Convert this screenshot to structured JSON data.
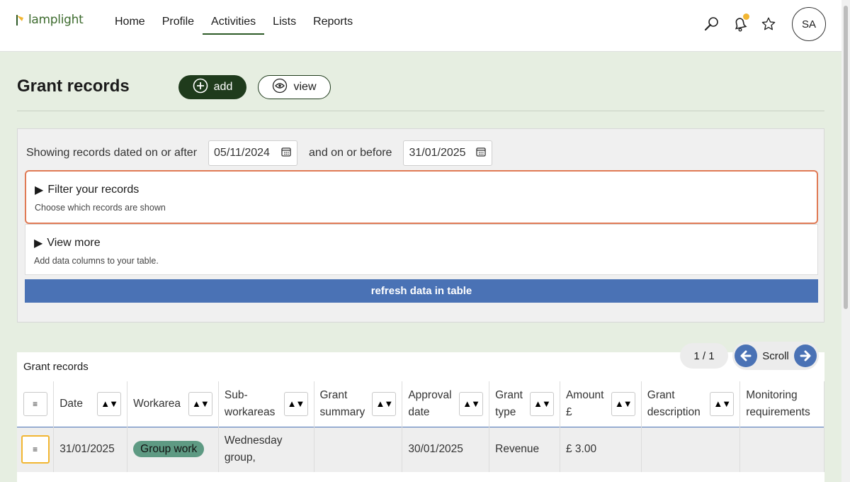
{
  "app": {
    "logo_text": "lamplight"
  },
  "nav": {
    "items": [
      {
        "label": "Home",
        "active": false
      },
      {
        "label": "Profile",
        "active": false
      },
      {
        "label": "Activities",
        "active": true
      },
      {
        "label": "Lists",
        "active": false
      },
      {
        "label": "Reports",
        "active": false
      }
    ],
    "avatar_initials": "SA",
    "icons": [
      "search-icon",
      "bell-icon",
      "star-icon"
    ]
  },
  "header": {
    "title": "Grant records",
    "add_label": "add",
    "view_label": "view"
  },
  "filters": {
    "prefix_text": "Showing records dated on or after",
    "start_date": "05/11/2024",
    "middle_text": "and on or before",
    "end_date": "31/01/2025",
    "filter_title": "Filter your records",
    "filter_sub": "Choose which records are shown",
    "viewmore_title": "View more",
    "viewmore_sub": "Add data columns to your table.",
    "refresh_label": "refresh data in table"
  },
  "table": {
    "caption": "Grant records",
    "pager": "1 / 1",
    "scroll_label": "Scroll",
    "columns": [
      "Date",
      "Workarea",
      "Sub-workareas",
      "Grant summary",
      "Approval date",
      "Grant type",
      "Amount £",
      "Grant description",
      "Monitoring requirements"
    ],
    "rows": [
      {
        "date": "31/01/2025",
        "workarea": "Group work",
        "sub_workareas": "Wednesday group,",
        "grant_summary": "",
        "approval_date": "30/01/2025",
        "grant_type": "Revenue",
        "amount": "£ 3.00",
        "grant_description": "",
        "monitoring": ""
      }
    ]
  },
  "colors": {
    "brand_green": "#1f3b1c",
    "accent_blue": "#4a72b5",
    "highlight_orange": "#e07a55",
    "notif_yellow": "#f2b632",
    "pill_green": "#5e9a83"
  }
}
